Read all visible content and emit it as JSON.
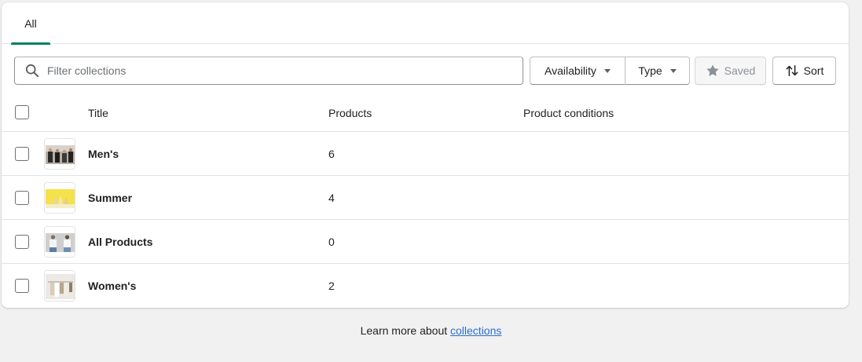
{
  "tabs": [
    {
      "label": "All",
      "active": true
    }
  ],
  "search": {
    "placeholder": "Filter collections",
    "value": ""
  },
  "filters": {
    "availability_label": "Availability",
    "type_label": "Type",
    "saved_label": "Saved",
    "sort_label": "Sort"
  },
  "table": {
    "columns": [
      "Title",
      "Products",
      "Product conditions"
    ],
    "rows": [
      {
        "title": "Men's",
        "products": "6",
        "conditions": "",
        "thumbnail": "mens-collection-image"
      },
      {
        "title": "Summer",
        "products": "4",
        "conditions": "",
        "thumbnail": "summer-collection-image"
      },
      {
        "title": "All Products",
        "products": "0",
        "conditions": "",
        "thumbnail": "all-products-collection-image"
      },
      {
        "title": "Women's",
        "products": "2",
        "conditions": "",
        "thumbnail": "womens-collection-image"
      }
    ]
  },
  "footer": {
    "text": "Learn more about ",
    "link": "collections"
  },
  "colors": {
    "accent": "#008060",
    "link": "#2c6ecb",
    "background": "#f1f1f1"
  },
  "icons": [
    "search-icon",
    "caret-down-icon",
    "star-icon",
    "sort-icon"
  ]
}
